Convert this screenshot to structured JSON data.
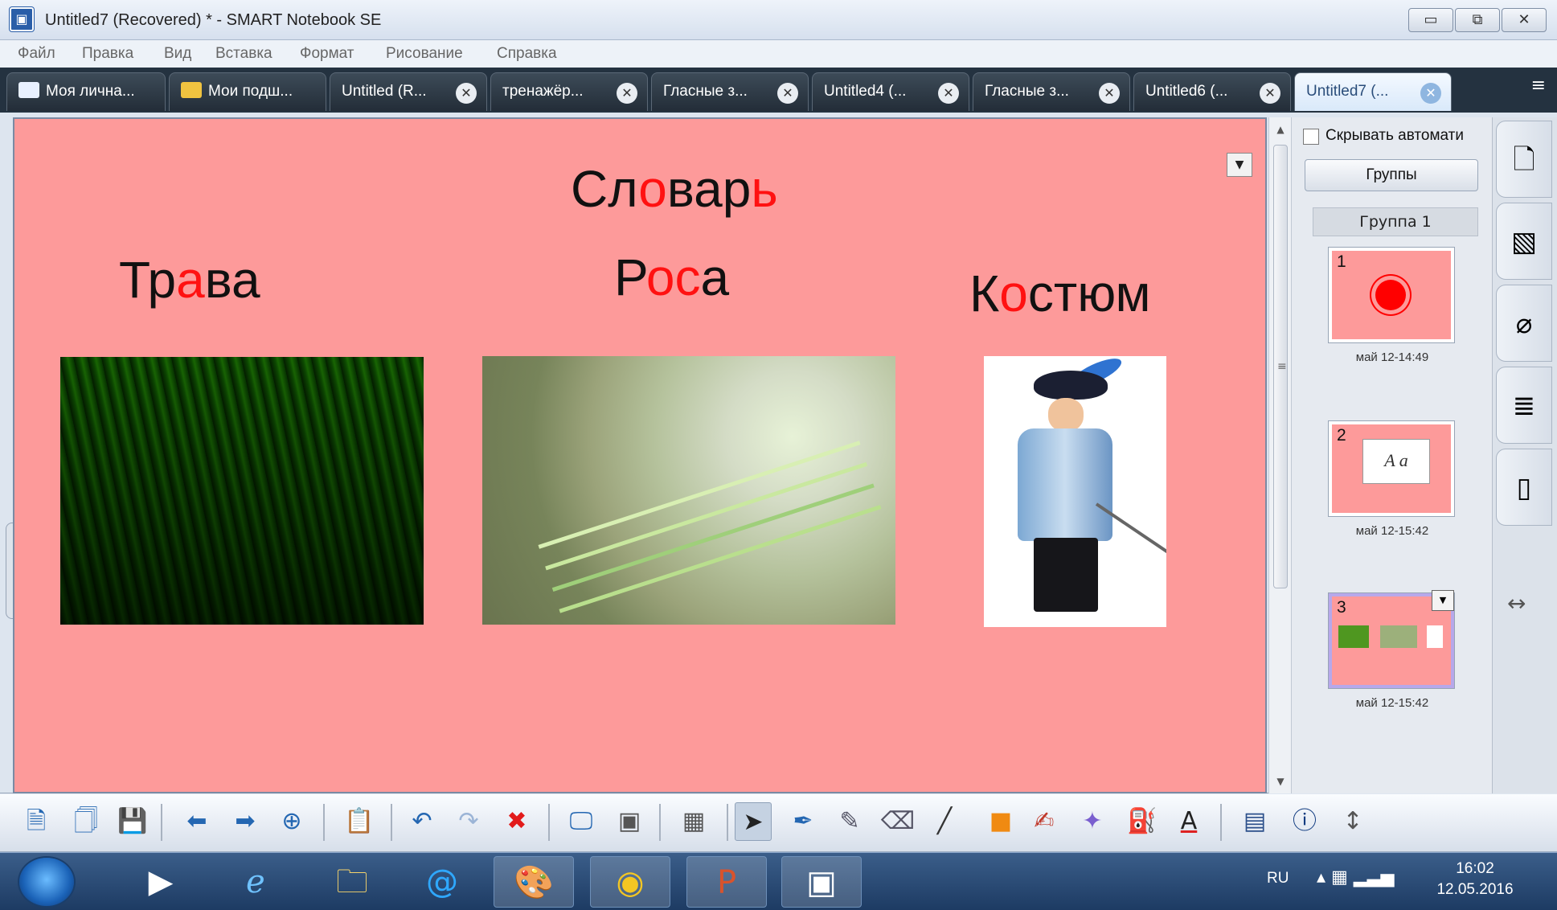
{
  "window": {
    "title": "Untitled7 (Recovered) * - SMART Notebook SE"
  },
  "menubar": {
    "items": [
      "Файл",
      "Правка",
      "Вид",
      "Вставка",
      "Формат",
      "Рисование",
      "Справка"
    ]
  },
  "tabs": [
    {
      "label": "Моя лична...",
      "icon": "home-icon"
    },
    {
      "label": "Мои подш...",
      "icon": "folder-icon"
    },
    {
      "label": "Untitled (R...",
      "icon": "close-icon"
    },
    {
      "label": "тренажёр...",
      "icon": "close-icon"
    },
    {
      "label": "Гласные з...",
      "icon": "close-icon"
    },
    {
      "label": "Untitled4 (...",
      "icon": "close-icon"
    },
    {
      "label": "Гласные з...",
      "icon": "close-icon"
    },
    {
      "label": "Untitled6 (...",
      "icon": "close-icon"
    },
    {
      "label": "Untitled7 (...",
      "icon": "close-icon",
      "active": true
    }
  ],
  "page": {
    "title": {
      "parts": [
        "Сл",
        "о",
        "вар",
        "ь"
      ]
    },
    "words": [
      {
        "parts": [
          "Тр",
          "а",
          "ва"
        ]
      },
      {
        "parts": [
          "Р",
          "ос",
          "а"
        ]
      },
      {
        "parts": [
          "К",
          "о",
          "стюм"
        ]
      }
    ],
    "images": [
      "grass-photo",
      "dew-photo",
      "musketeer-costume-photo"
    ]
  },
  "side_panel": {
    "autohide_label": "Скрывать автомати",
    "groups_button": "Группы",
    "group_name": "Группа 1",
    "pages": [
      {
        "number": "1",
        "time": "май 12-14:49"
      },
      {
        "number": "2",
        "time": "май 12-15:42"
      },
      {
        "number": "3",
        "time": "май 12-15:42"
      }
    ]
  },
  "toolbar": {
    "icons": [
      "new-page-icon",
      "open-icon",
      "save-icon",
      "back-icon",
      "forward-icon",
      "add-page-icon",
      "paste-icon",
      "undo-icon",
      "redo-icon",
      "delete-icon",
      "screen-shade-icon",
      "screen-capture-icon",
      "table-icon",
      "select-icon",
      "pen-icon",
      "creative-pen-icon",
      "eraser-icon",
      "line-icon",
      "shape-icon",
      "highlighter-icon",
      "magic-pen-icon",
      "fill-icon",
      "text-icon",
      "lesson-activity-icon",
      "response-icon",
      "move-toolbar-icon"
    ]
  },
  "taskbar": {
    "language": "RU",
    "time": "16:02",
    "date": "12.05.2016"
  },
  "colors": {
    "canvas": "#fd9a9a",
    "accent_red": "#ff1111",
    "tab_bar": "#243240"
  }
}
